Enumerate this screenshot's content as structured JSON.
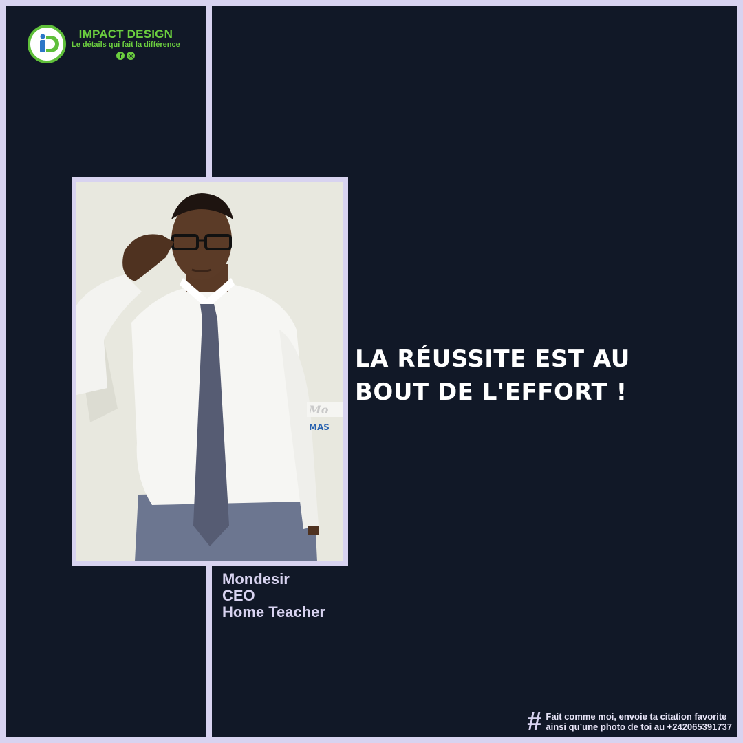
{
  "brand": {
    "name": "IMPACT DESIGN",
    "tagline": "Le détails qui fait la différence",
    "logo_letters": "iD",
    "social_icons": [
      "facebook-icon",
      "instagram-icon"
    ]
  },
  "quote": {
    "line1": "LA RÉUSSITE EST AU",
    "line2": "BOUT DE L'EFFORT !"
  },
  "person": {
    "name": "Mondesir",
    "role": "CEO",
    "title": "Home Teacher"
  },
  "footer": {
    "icon": "hashtag-icon",
    "line1": "Fait comme moi, envoie ta citation favorite",
    "line2": "ainsi qu’une photo de toi au +242065391737"
  },
  "colors": {
    "background": "#111827",
    "frame": "#d8d3f0",
    "brand_green": "#6ccf3f",
    "quote_text": "#ffffff"
  }
}
